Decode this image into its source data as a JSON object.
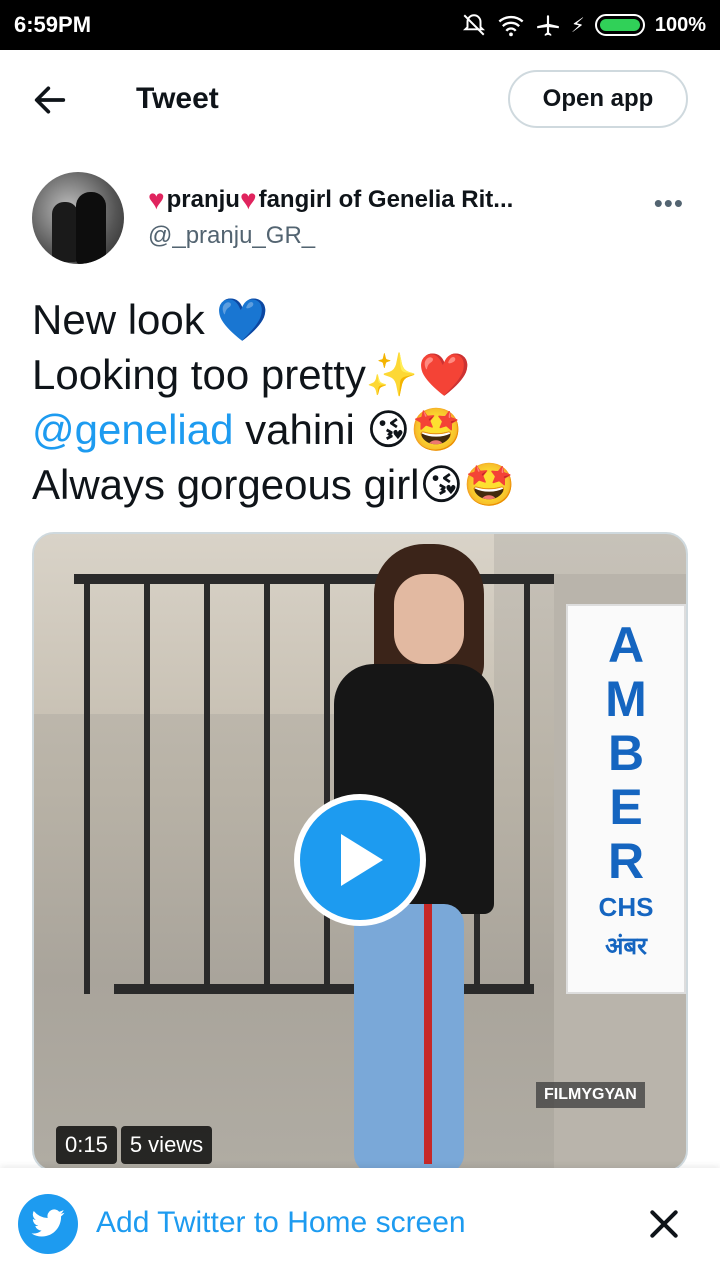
{
  "status_bar": {
    "time": "6:59PM",
    "battery": "100%"
  },
  "header": {
    "title": "Tweet",
    "open_app_label": "Open app"
  },
  "author": {
    "display_name": "pranju",
    "display_name_suffix": "fangirl of Genelia Rit...",
    "handle": "@_pranju_GR_",
    "more_label": "•••"
  },
  "tweet": {
    "lines": [
      {
        "text": "New look ",
        "emoji": "💙"
      },
      {
        "text": "Looking too pretty",
        "emoji": "✨❤️"
      },
      {
        "mention": "@geneliad",
        "text": " vahini ",
        "emoji": "😘🤩"
      },
      {
        "text": "Always gorgeous girl",
        "emoji": "😘🤩"
      }
    ]
  },
  "media": {
    "sign_letters": [
      "A",
      "M",
      "B",
      "E",
      "R"
    ],
    "sign_chs": "CHS",
    "sign_hindi": "अंबर",
    "watermark": "FILMYGYAN",
    "duration": "0:15",
    "views": "5 views"
  },
  "banner": {
    "text": "Add Twitter to Home screen"
  },
  "colors": {
    "accent": "#1d9bf0",
    "text": "#0f1419",
    "muted": "#536471",
    "heart": "#e0245e"
  }
}
